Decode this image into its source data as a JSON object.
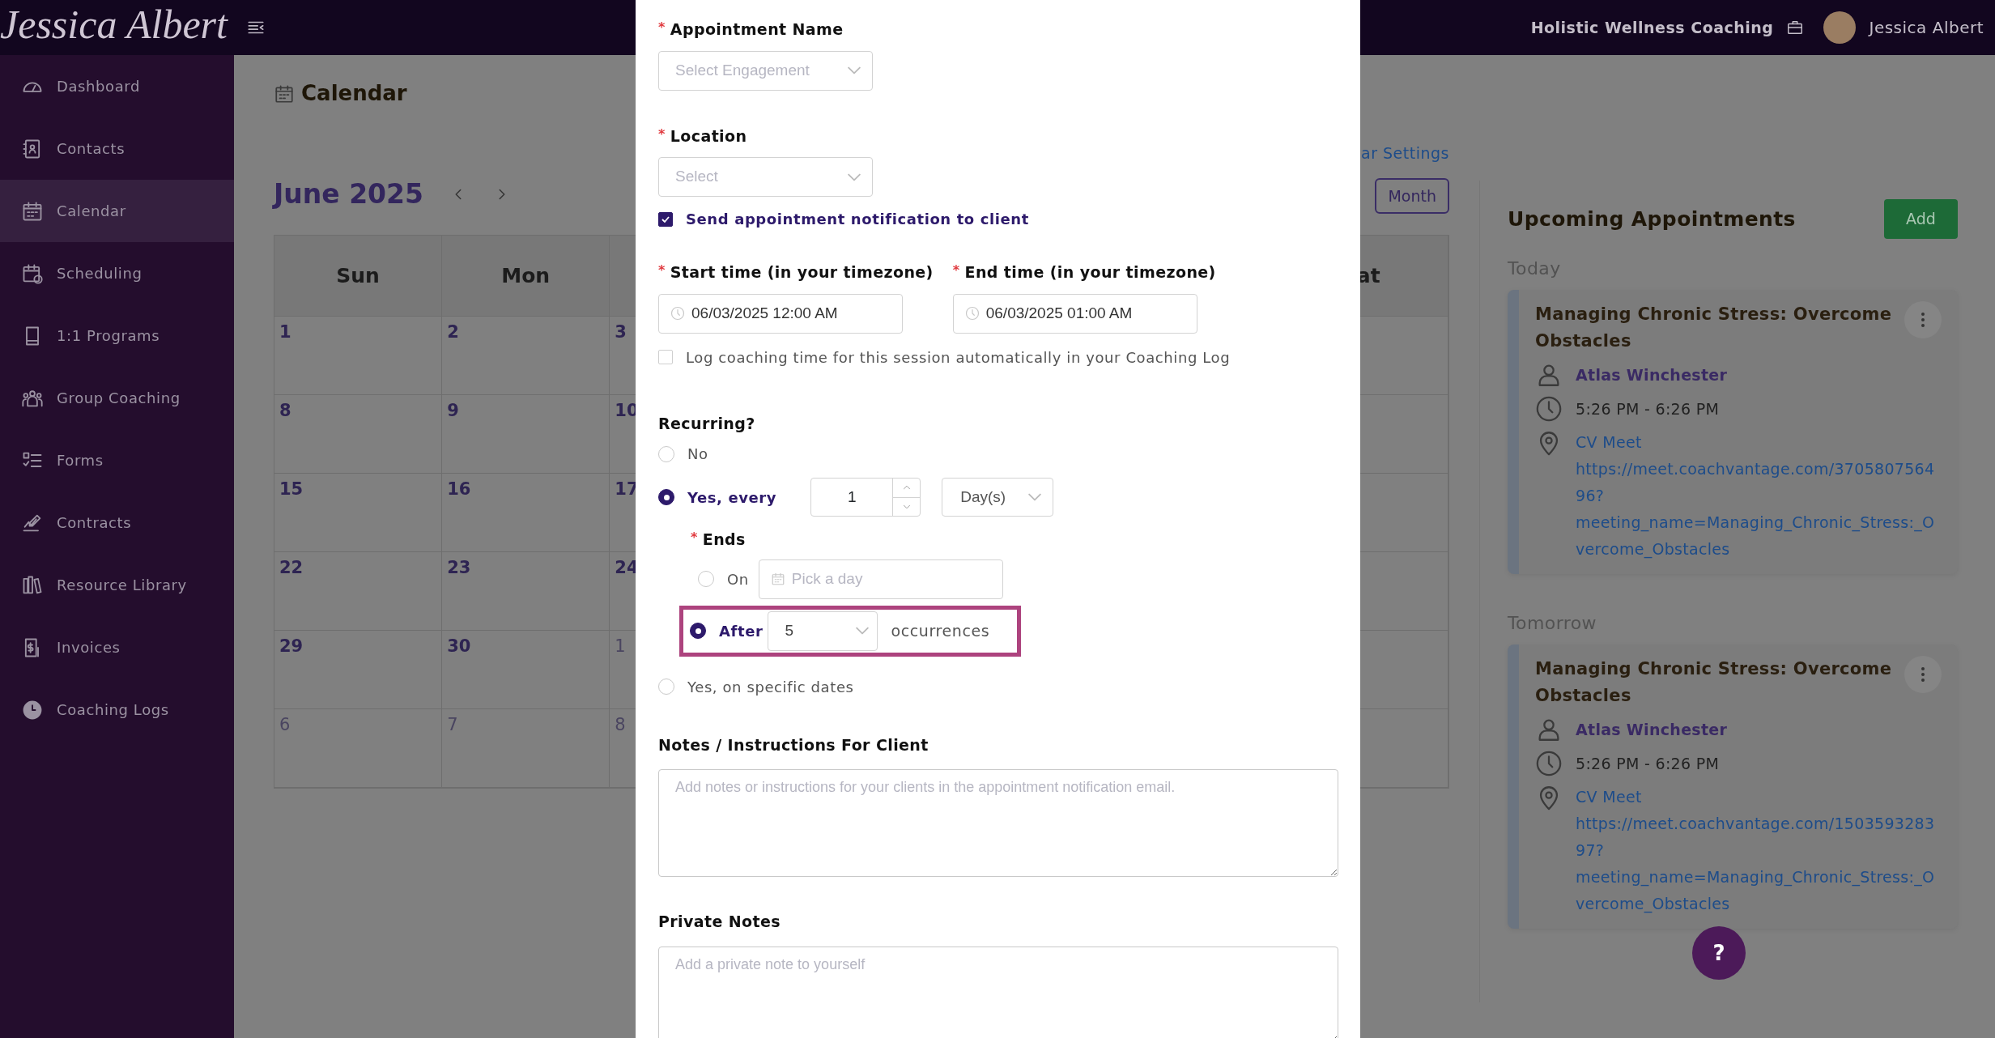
{
  "topbar": {
    "logo": "Jessica Albert",
    "org": "Holistic Wellness Coaching",
    "user": "Jessica Albert"
  },
  "sidebar": {
    "items": [
      {
        "label": "Dashboard",
        "selected": false
      },
      {
        "label": "Contacts",
        "selected": false
      },
      {
        "label": "Calendar",
        "selected": true
      },
      {
        "label": "Scheduling",
        "selected": false
      },
      {
        "label": "1:1 Programs",
        "selected": false
      },
      {
        "label": "Group Coaching",
        "selected": false
      },
      {
        "label": "Forms",
        "selected": false
      },
      {
        "label": "Contracts",
        "selected": false
      },
      {
        "label": "Resource Library",
        "selected": false
      },
      {
        "label": "Invoices",
        "selected": false
      },
      {
        "label": "Coaching Logs",
        "selected": false
      }
    ]
  },
  "page": {
    "title": "Calendar"
  },
  "calendar": {
    "month": "June 2025",
    "settings_link": "ar Settings",
    "view_button": "Month",
    "columns": [
      {
        "header": "Sun",
        "days": [
          {
            "label": "1",
            "muted": false
          },
          {
            "label": "8",
            "muted": false
          },
          {
            "label": "15",
            "muted": false
          },
          {
            "label": "22",
            "muted": false
          },
          {
            "label": "29",
            "muted": false
          },
          {
            "label": "6",
            "muted": true
          }
        ]
      },
      {
        "header": "Mon",
        "days": [
          {
            "label": "2",
            "muted": false
          },
          {
            "label": "9",
            "muted": false
          },
          {
            "label": "16",
            "muted": false
          },
          {
            "label": "23",
            "muted": false
          },
          {
            "label": "30",
            "muted": false
          },
          {
            "label": "7",
            "muted": true
          }
        ]
      },
      {
        "days": [
          {
            "label": "3",
            "muted": false
          },
          {
            "label": "10",
            "muted": false
          },
          {
            "label": "17",
            "muted": false
          },
          {
            "label": "24",
            "muted": false
          },
          {
            "label": "1",
            "muted": true
          },
          {
            "label": "8",
            "muted": true
          }
        ]
      }
    ],
    "last_column": {
      "header": "at"
    }
  },
  "upcoming": {
    "title": "Upcoming Appointments",
    "add_button": "Add",
    "groups": [
      {
        "label": "Today",
        "appointments": [
          {
            "title": "Managing Chronic Stress: Overcome Obstacles",
            "client": "Atlas Winchester",
            "time": "5:26 PM - 6:26 PM",
            "location": "CV Meet",
            "link": "https://meet.coachvantage.com/370580756496?meeting_name=Managing_Chronic_Stress:_Overcome_Obstacles"
          }
        ]
      },
      {
        "label": "Tomorrow",
        "appointments": [
          {
            "title": "Managing Chronic Stress: Overcome Obstacles",
            "client": "Atlas Winchester",
            "time": "5:26 PM - 6:26 PM",
            "location": "CV Meet",
            "link": "https://meet.coachvantage.com/150359328397?meeting_name=Managing_Chronic_Stress:_Overcome_Obstacles"
          }
        ]
      }
    ]
  },
  "help_button": "?",
  "modal": {
    "appointment_name": {
      "required_mark": "*",
      "label": "Appointment Name",
      "placeholder": "Select Engagement"
    },
    "location": {
      "required_mark": "*",
      "label": "Location",
      "placeholder": "Select"
    },
    "send_notification": {
      "label": "Send appointment notification to client",
      "checked": true
    },
    "start_time": {
      "required_mark": "*",
      "label": "Start time (in your timezone)",
      "value": "06/03/2025 12:00 AM"
    },
    "end_time": {
      "required_mark": "*",
      "label": "End time (in your timezone)",
      "value": "06/03/2025 01:00 AM"
    },
    "log_time": {
      "label": "Log coaching time for this session automatically in your Coaching Log",
      "checked": false
    },
    "recurring": {
      "label": "Recurring?",
      "options": [
        {
          "label": "No",
          "selected": false
        },
        {
          "label": "Yes, every",
          "selected": true
        },
        {
          "label": "Yes, on specific dates",
          "selected": false
        }
      ],
      "interval": "1",
      "unit": "Day(s)",
      "ends": {
        "required_mark": "*",
        "label": "Ends",
        "on": {
          "label": "On",
          "selected": false,
          "placeholder": "Pick a day"
        },
        "after": {
          "label": "After",
          "selected": true,
          "value": "5",
          "suffix": "occurrences",
          "highlighted": true
        }
      }
    },
    "notes": {
      "label": "Notes / Instructions For Client",
      "placeholder": "Add notes or instructions for your clients in the appointment notification email."
    },
    "private_notes": {
      "label": "Private Notes",
      "placeholder": "Add a private note to yourself"
    }
  }
}
